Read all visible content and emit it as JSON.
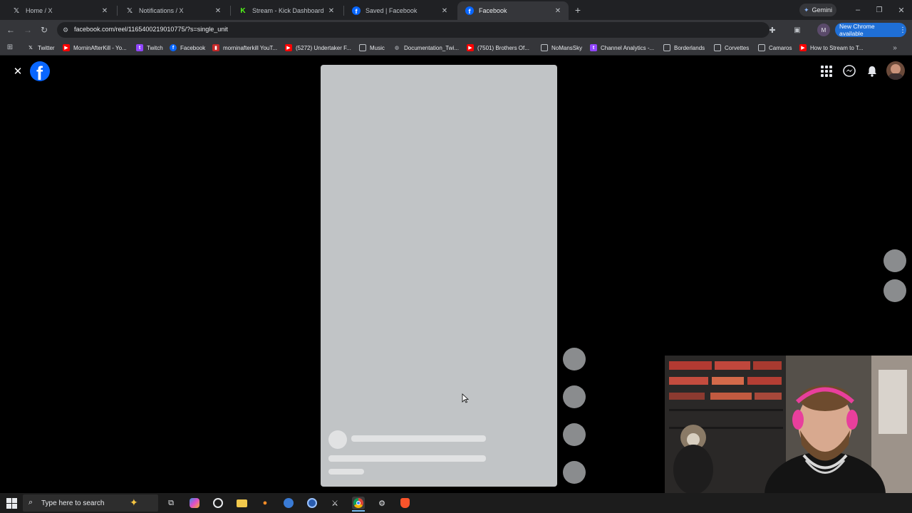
{
  "browser": {
    "tabs": [
      {
        "label": "Home / X",
        "icon": "x-logo-icon",
        "active": false
      },
      {
        "label": "Notifications / X",
        "icon": "x-logo-icon",
        "active": false
      },
      {
        "label": "Stream - Kick Dashboard",
        "icon": "kick-logo-icon",
        "active": false
      },
      {
        "label": "Saved | Facebook",
        "icon": "facebook-logo-icon",
        "active": false
      },
      {
        "label": "Facebook",
        "icon": "facebook-logo-icon",
        "active": true
      }
    ],
    "new_tab_glyph": "+",
    "gemini_label": "Gemini",
    "url": "facebook.com/reel/1165400219010775/?s=single_unit",
    "profile_initial": "M",
    "update_label": "New Chrome available",
    "bookmarks": [
      {
        "label": "Twitter",
        "icon": "x-logo-icon"
      },
      {
        "label": "MorninAfterKill - Yo...",
        "icon": "youtube-icon"
      },
      {
        "label": "Twitch",
        "icon": "twitch-icon"
      },
      {
        "label": "Facebook",
        "icon": "facebook-logo-icon"
      },
      {
        "label": "morninafterkill YouT...",
        "icon": "analytics-icon"
      },
      {
        "label": "(5272) Undertaker F...",
        "icon": "youtube-icon"
      },
      {
        "label": "Music",
        "icon": "folder-icon"
      },
      {
        "label": "Documentation_Twi...",
        "icon": "globe-icon"
      },
      {
        "label": "(7501) Brothers Of...",
        "icon": "youtube-icon"
      },
      {
        "label": "NoMansSky",
        "icon": "folder-icon"
      },
      {
        "label": "Channel Analytics -...",
        "icon": "twitch-icon"
      },
      {
        "label": "Borderlands",
        "icon": "folder-icon"
      },
      {
        "label": "Corvettes",
        "icon": "folder-icon"
      },
      {
        "label": "Camaros",
        "icon": "folder-icon"
      },
      {
        "label": "How to Stream to T...",
        "icon": "youtube-icon"
      }
    ]
  },
  "viewer": {
    "close_glyph": "✕",
    "brand_letter": "f",
    "state": "loading"
  },
  "taskbar": {
    "search_placeholder": "Type here to search"
  },
  "colors": {
    "facebook_blue": "#0866ff",
    "chrome_update_blue": "#1f6fd6",
    "skeleton": "#c1c4c6"
  }
}
